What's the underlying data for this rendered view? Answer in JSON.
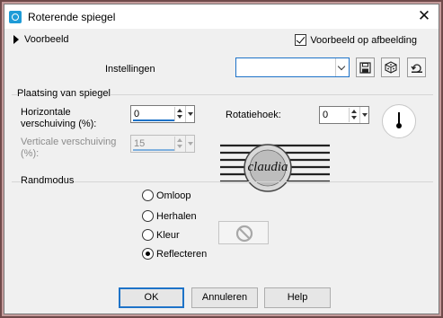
{
  "window": {
    "title": "Roterende spiegel"
  },
  "preview": {
    "label": "Voorbeeld",
    "on_image_label": "Voorbeeld op afbeelding",
    "on_image_checked": true
  },
  "settings": {
    "label": "Instellingen",
    "preset_value": ""
  },
  "placement": {
    "title": "Plaatsing van spiegel",
    "horizontal_label_1": "Horizontale",
    "horizontal_label_2": "verschuiving (%):",
    "horizontal_value": "0",
    "vertical_label_1": "Verticale verschuiving",
    "vertical_label_2": "(%):",
    "vertical_value": "15",
    "rotation_label": "Rotatiehoek:",
    "rotation_value": "0"
  },
  "watermark": {
    "text": "claudia"
  },
  "edge_mode": {
    "title": "Randmodus",
    "options": [
      "Omloop",
      "Herhalen",
      "Kleur",
      "Reflecteren"
    ],
    "selected": "Reflecteren"
  },
  "buttons": {
    "ok": "OK",
    "cancel": "Annuleren",
    "help": "Help"
  },
  "colors": {
    "accent": "#1e73c8",
    "frame_outer": "#6f4a4a",
    "frame_inner": "#c49a9a",
    "dialog_bg": "#f0f0f0"
  }
}
